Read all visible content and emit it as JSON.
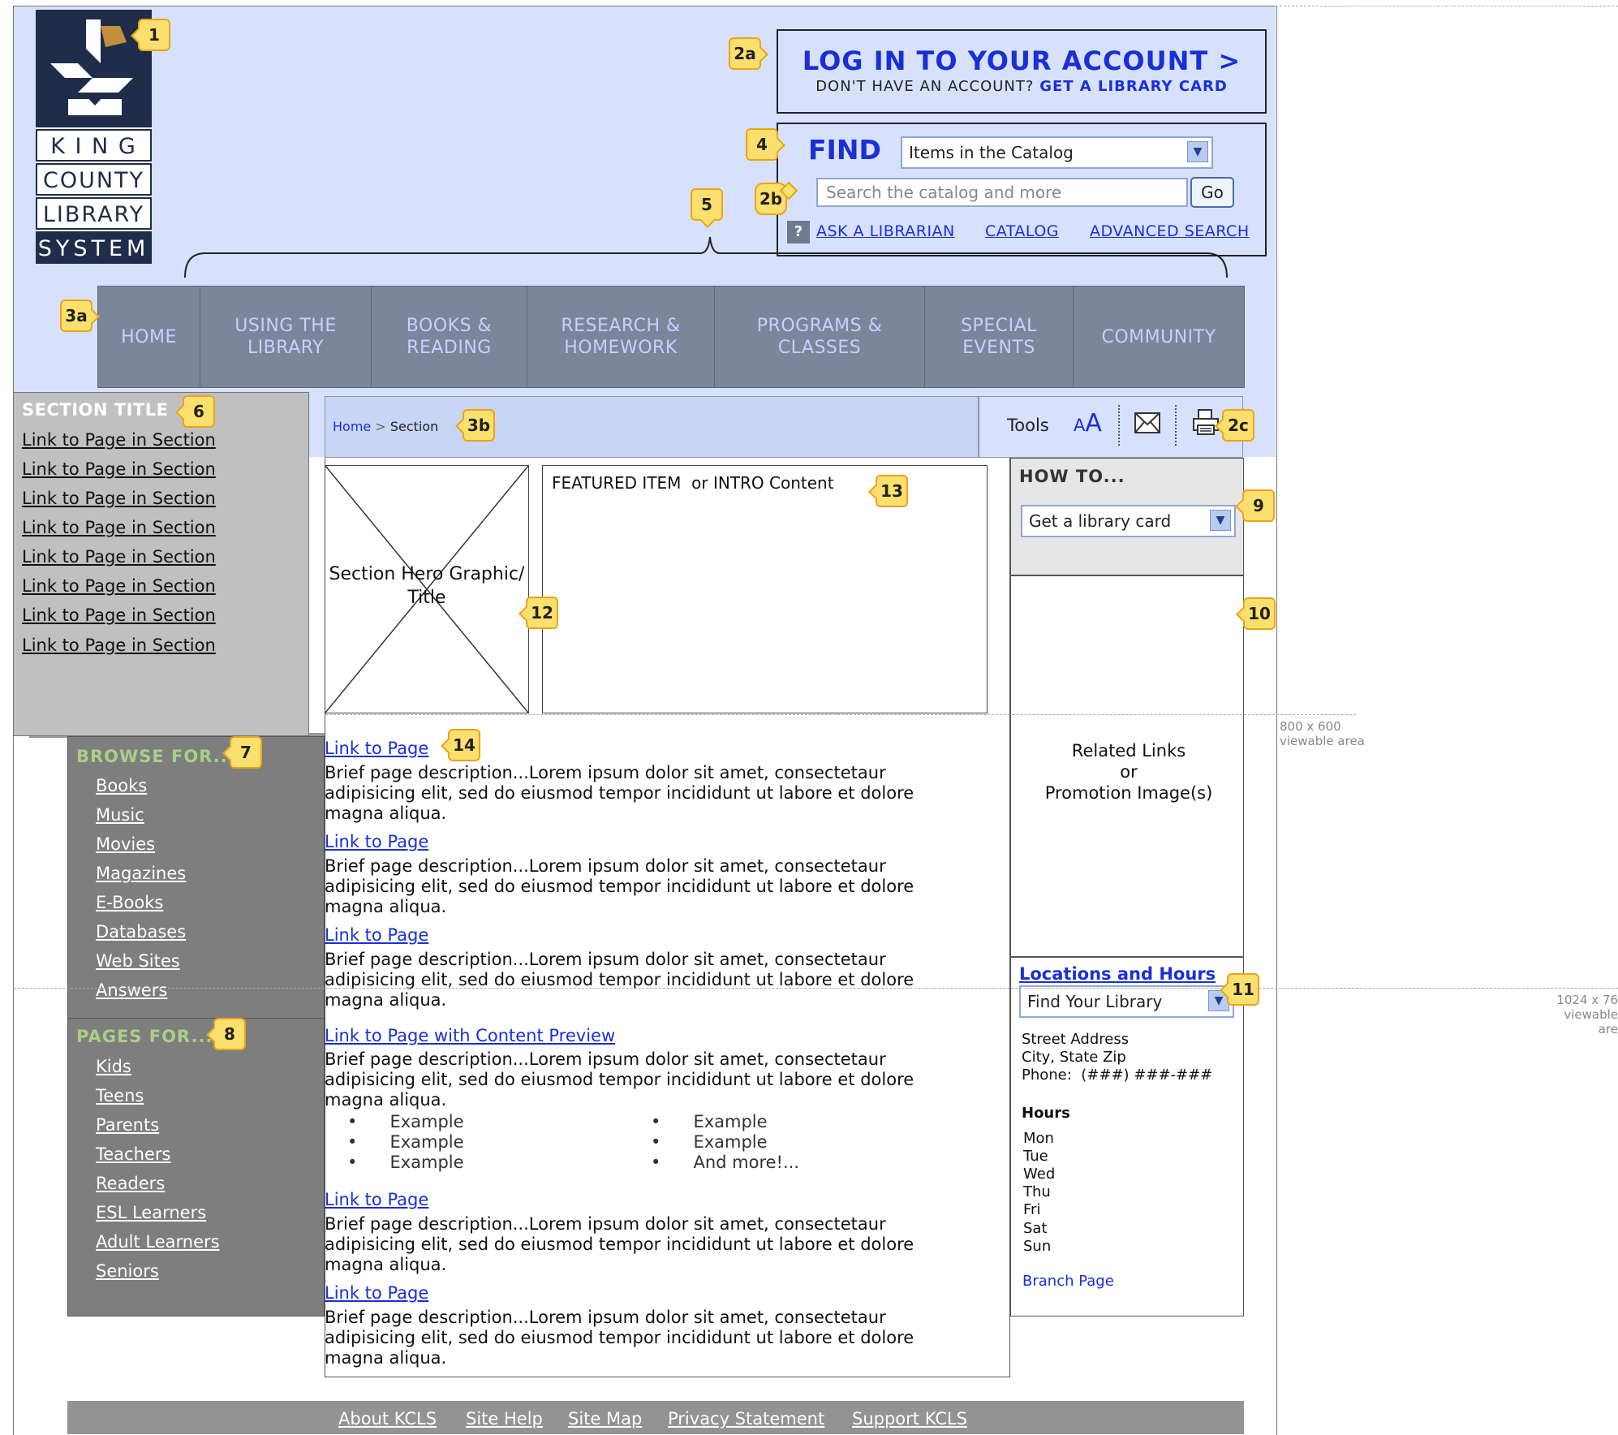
{
  "logo": {
    "line1": "K I N G",
    "line2": "COUNTY",
    "line3": "LIBRARY",
    "line4": "SYSTEM"
  },
  "callouts": {
    "c1": "1",
    "c2a": "2a",
    "c2b": "2b",
    "c2c": "2c",
    "c3a": "3a",
    "c3b": "3b",
    "c4": "4",
    "c5": "5",
    "c6": "6",
    "c7": "7",
    "c8": "8",
    "c9": "9",
    "c10": "10",
    "c11": "11",
    "c12": "12",
    "c13": "13",
    "c14": "14"
  },
  "login": {
    "title": "LOG IN TO YOUR ACCOUNT >",
    "prompt": "DON'T HAVE AN ACCOUNT?",
    "card_link": "GET A LIBRARY CARD"
  },
  "find": {
    "label": "FIND",
    "selected": "Items in the Catalog",
    "placeholder": "Search the catalog and more",
    "go": "Go",
    "help_icon": "?",
    "links": [
      "ASK A LIBRARIAN",
      "CATALOG",
      "ADVANCED SEARCH"
    ]
  },
  "nav": {
    "items": [
      "HOME",
      "USING THE\nLIBRARY",
      "BOOKS &\nREADING",
      "RESEARCH &\nHOMEWORK",
      "PROGRAMS &\nCLASSES",
      "SPECIAL\nEVENTS",
      "COMMUNITY"
    ]
  },
  "breadcrumb": {
    "home": "Home",
    "separator": ">",
    "current": "Section"
  },
  "tools": {
    "label": "Tools",
    "font_small": "A",
    "font_large": "A",
    "icons": [
      "font-size-icon",
      "email-icon",
      "print-icon"
    ]
  },
  "section": {
    "title": "SECTION TITLE",
    "links": [
      "Link to Page in Section",
      "Link to Page in Section",
      "Link to Page in Section",
      "Link to Page in Section",
      "Link to Page in Section",
      "Link to Page in Section",
      "Link to Page in Section",
      "Link to Page in Section"
    ]
  },
  "browse": {
    "title": "BROWSE FOR...",
    "links": [
      "Books",
      "Music",
      "Movies",
      "Magazines",
      "E-Books",
      "Databases",
      "Web Sites",
      "Answers"
    ]
  },
  "pages_for": {
    "title": "PAGES FOR...",
    "links": [
      "Kids",
      "Teens",
      "Parents",
      "Teachers",
      "Readers",
      "ESL Learners",
      "Adult Learners",
      "Seniors"
    ]
  },
  "hero": {
    "text": "Section Hero Graphic/\nTitle"
  },
  "featured": {
    "text": "FEATURED ITEM  or INTRO Content"
  },
  "main": {
    "entries": [
      {
        "link": "Link to Page",
        "desc": "Brief page description...Lorem ipsum dolor sit amet, consectetaur adipisicing elit, sed do eiusmod tempor incididunt ut labore et dolore magna aliqua."
      },
      {
        "link": "Link to Page",
        "desc": "Brief page description...Lorem ipsum dolor sit amet, consectetaur adipisicing elit, sed do eiusmod tempor incididunt ut labore et dolore magna aliqua."
      },
      {
        "link": "Link to Page",
        "desc": "Brief page description...Lorem ipsum dolor sit amet, consectetaur adipisicing elit, sed do eiusmod tempor incididunt ut labore et dolore magna aliqua."
      },
      {
        "link": "Link to Page with Content Preview",
        "desc": "Brief page description...Lorem ipsum dolor sit amet, consectetaur adipisicing elit, sed do eiusmod tempor incididunt ut labore et dolore magna aliqua."
      },
      {
        "link": "Link to Page",
        "desc": "Brief page description...Lorem ipsum dolor sit amet, consectetaur adipisicing elit, sed do eiusmod tempor incididunt ut labore et dolore magna aliqua."
      },
      {
        "link": "Link to Page",
        "desc": "Brief page description...Lorem ipsum dolor sit amet, consectetaur adipisicing elit, sed do eiusmod tempor incididunt ut labore et dolore magna aliqua."
      }
    ],
    "bullets_left": [
      "Example",
      "Example",
      "Example"
    ],
    "bullets_right": [
      "Example",
      "Example",
      "And more!..."
    ]
  },
  "howto": {
    "title": "HOW TO...",
    "selected": "Get a library card"
  },
  "promo": {
    "text": "Related Links\nor\nPromotion Image(s)"
  },
  "locations": {
    "title": "Locations and Hours",
    "selected": "Find Your Library",
    "street": "Street Address",
    "city": "City, State Zip",
    "phone": "Phone:  (###) ###-###",
    "hours_title": "Hours",
    "days": [
      "Mon",
      "Tue",
      "Wed",
      "Thu",
      "Fri",
      "Sat",
      "Sun"
    ],
    "branch_link": "Branch Page"
  },
  "guides": {
    "g800": "800 x 600\nviewable area",
    "g1024": "1024 x 76\nviewable are"
  },
  "footer": {
    "links": [
      "About KCLS",
      "Site Help",
      "Site Map",
      "Privacy Statement",
      "Support KCLS"
    ]
  },
  "colors": {
    "header_bg": "#d7e1fb",
    "nav_bg": "#7b869b",
    "nav_text": "#c7d0ff",
    "link": "#1a2fd6",
    "callout": "#fce06d",
    "dark_panel": "#7e7e7e",
    "browse_head": "#a8d087"
  }
}
